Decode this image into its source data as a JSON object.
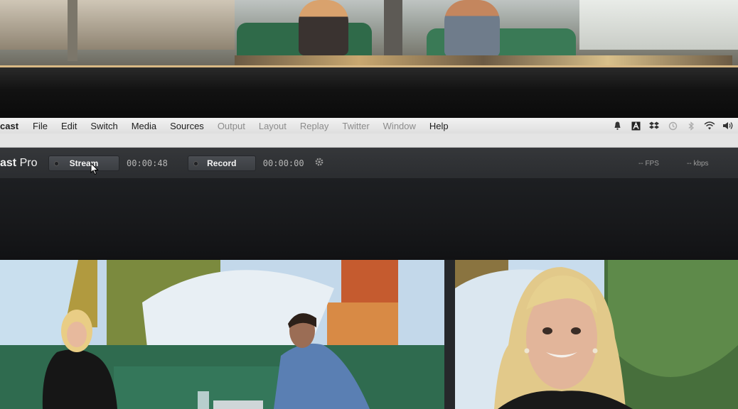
{
  "menubar": {
    "app_name": "cast",
    "items": [
      "File",
      "Edit",
      "Switch",
      "Media",
      "Sources",
      "Output",
      "Layout",
      "Replay",
      "Twitter",
      "Window",
      "Help"
    ],
    "dim_items": [
      "Output",
      "Layout",
      "Replay",
      "Twitter",
      "Window"
    ],
    "status_icons": [
      "notification-icon",
      "adobe-icon",
      "dropbox-icon",
      "time-machine-icon",
      "bluetooth-icon",
      "wifi-icon",
      "volume-icon"
    ]
  },
  "toolbar": {
    "brand_prefix": "ast",
    "brand_suffix": " Pro",
    "stream_label": "Stream",
    "stream_timer": "00:00:48",
    "record_label": "Record",
    "record_timer": "00:00:00",
    "fps_label": "-- FPS",
    "kbps_label": "-- kbps"
  },
  "colors": {
    "menubar": "#e6e6e6",
    "toolbar": "#303235",
    "button": "#44474b",
    "accent_wall": "#d9b985"
  }
}
